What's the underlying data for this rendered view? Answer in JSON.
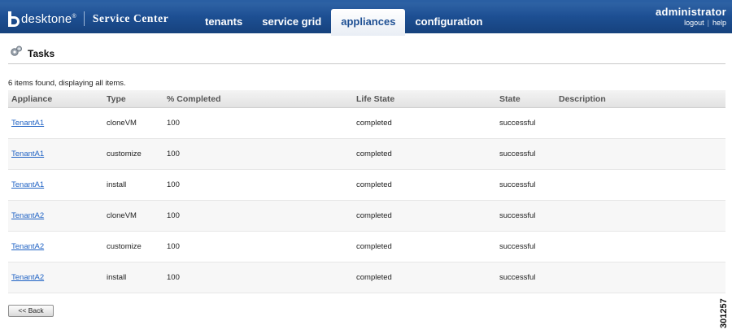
{
  "header": {
    "brand": "desktone",
    "brand_mark": "®",
    "product": "Service Center",
    "tabs": [
      {
        "label": "tenants",
        "active": false
      },
      {
        "label": "service grid",
        "active": false
      },
      {
        "label": "appliances",
        "active": true
      },
      {
        "label": "configuration",
        "active": false
      }
    ],
    "user": "administrator",
    "logout_label": "logout",
    "help_label": "help",
    "separator": "|"
  },
  "page": {
    "title": "Tasks",
    "title_icon": "gear-icon"
  },
  "table": {
    "summary": "6 items found, displaying all items.",
    "columns": [
      "Appliance",
      "Type",
      "% Completed",
      "Life State",
      "State",
      "Description"
    ],
    "rows": [
      {
        "appliance": "TenantA1",
        "type": "cloneVM",
        "completed": "100",
        "life_state": "completed",
        "state": "successful",
        "description": ""
      },
      {
        "appliance": "TenantA1",
        "type": "customize",
        "completed": "100",
        "life_state": "completed",
        "state": "successful",
        "description": ""
      },
      {
        "appliance": "TenantA1",
        "type": "install",
        "completed": "100",
        "life_state": "completed",
        "state": "successful",
        "description": ""
      },
      {
        "appliance": "TenantA2",
        "type": "cloneVM",
        "completed": "100",
        "life_state": "completed",
        "state": "successful",
        "description": ""
      },
      {
        "appliance": "TenantA2",
        "type": "customize",
        "completed": "100",
        "life_state": "completed",
        "state": "successful",
        "description": ""
      },
      {
        "appliance": "TenantA2",
        "type": "install",
        "completed": "100",
        "life_state": "completed",
        "state": "successful",
        "description": ""
      }
    ]
  },
  "back_label": "<< Back",
  "figure_id": "301257",
  "colors": {
    "nav_bar": "#1d4f93",
    "link": "#1f62c4",
    "active_tab_text": "#1d4f93"
  }
}
